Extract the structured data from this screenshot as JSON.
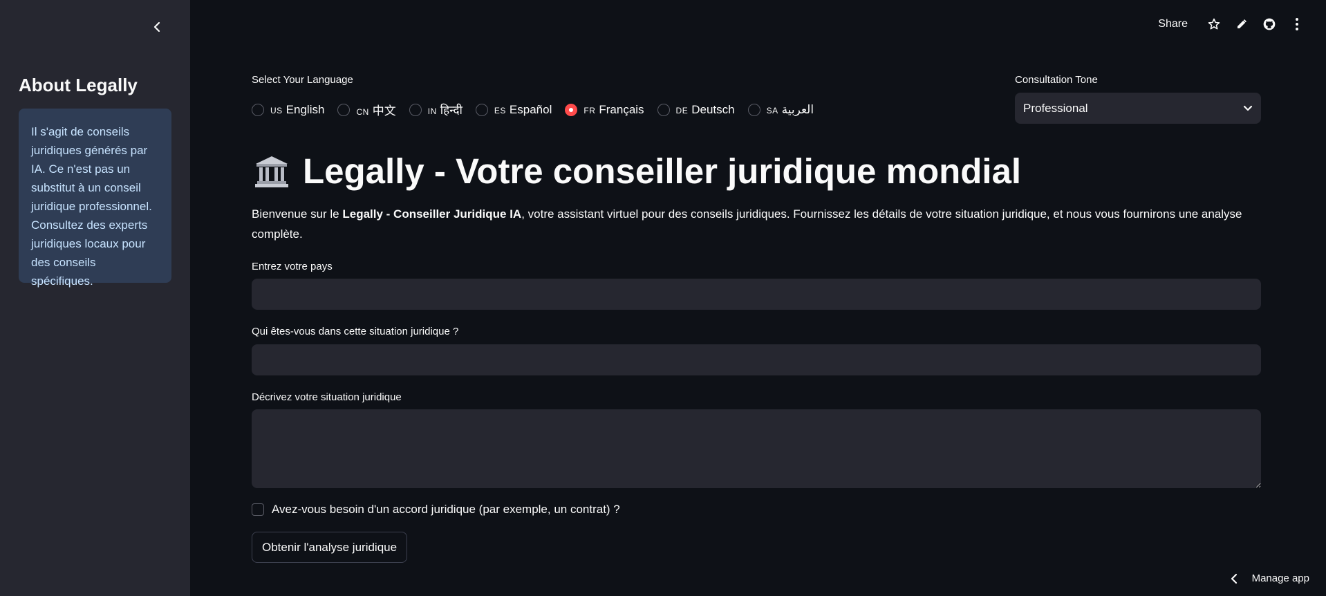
{
  "sidebar": {
    "title": "About Legally",
    "info": "Il s'agit de conseils juridiques générés par IA. Ce n'est pas un substitut à un conseil juridique professionnel. Consultez des experts juridiques locaux pour des conseils spécifiques."
  },
  "toolbar": {
    "share_label": "Share",
    "icons": [
      "star-icon",
      "pencil-icon",
      "github-icon",
      "more-vertical-icon"
    ]
  },
  "language": {
    "label": "Select Your Language",
    "options": [
      {
        "code": "US",
        "label": "English",
        "selected": false
      },
      {
        "code": "CN",
        "label": "中文",
        "selected": false
      },
      {
        "code": "IN",
        "label": "हिन्दी",
        "selected": false
      },
      {
        "code": "ES",
        "label": "Español",
        "selected": false
      },
      {
        "code": "FR",
        "label": "Français",
        "selected": true
      },
      {
        "code": "DE",
        "label": "Deutsch",
        "selected": false
      },
      {
        "code": "SA",
        "label": "العربية",
        "selected": false
      }
    ]
  },
  "tone": {
    "label": "Consultation Tone",
    "value": "Professional"
  },
  "header": {
    "icon": "classical-building-icon",
    "title": "Legally - Votre conseiller juridique mondial"
  },
  "intro": {
    "prefix": "Bienvenue sur le ",
    "bold": "Legally - Conseiller Juridique IA",
    "suffix": ", votre assistant virtuel pour des conseils juridiques. Fournissez les détails de votre situation juridique, et nous vous fournirons une analyse complète."
  },
  "form": {
    "country_label": "Entrez votre pays",
    "country_value": "",
    "role_label": "Qui êtes-vous dans cette situation juridique ?",
    "role_value": "",
    "situation_label": "Décrivez votre situation juridique",
    "situation_value": "",
    "agreement_label": "Avez-vous besoin d'un accord juridique (par exemple, un contrat) ?",
    "agreement_checked": false,
    "submit_label": "Obtenir l'analyse juridique"
  },
  "footer": {
    "manage_label": "Manage app"
  },
  "colors": {
    "background": "#0e1117",
    "sidebar": "#262730",
    "accent": "#ff4b4b",
    "info_box": "#2f3d55",
    "info_text": "#c7e3ff"
  }
}
